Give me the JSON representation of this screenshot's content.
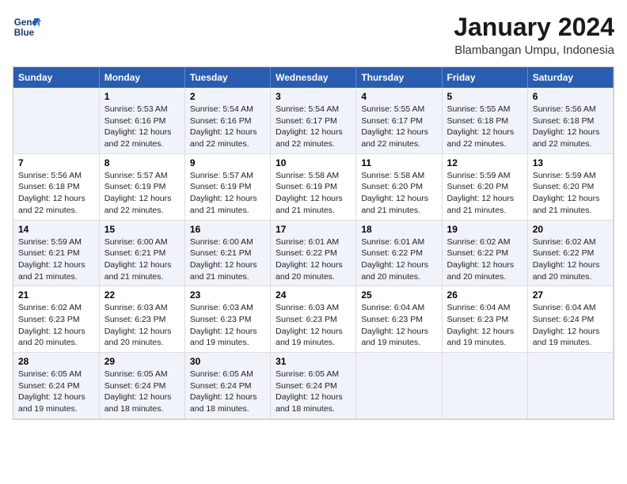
{
  "logo": {
    "line1": "General",
    "line2": "Blue"
  },
  "title": "January 2024",
  "subtitle": "Blambangan Umpu, Indonesia",
  "header_days": [
    "Sunday",
    "Monday",
    "Tuesday",
    "Wednesday",
    "Thursday",
    "Friday",
    "Saturday"
  ],
  "weeks": [
    [
      {
        "num": "",
        "info": ""
      },
      {
        "num": "1",
        "info": "Sunrise: 5:53 AM\nSunset: 6:16 PM\nDaylight: 12 hours\nand 22 minutes."
      },
      {
        "num": "2",
        "info": "Sunrise: 5:54 AM\nSunset: 6:16 PM\nDaylight: 12 hours\nand 22 minutes."
      },
      {
        "num": "3",
        "info": "Sunrise: 5:54 AM\nSunset: 6:17 PM\nDaylight: 12 hours\nand 22 minutes."
      },
      {
        "num": "4",
        "info": "Sunrise: 5:55 AM\nSunset: 6:17 PM\nDaylight: 12 hours\nand 22 minutes."
      },
      {
        "num": "5",
        "info": "Sunrise: 5:55 AM\nSunset: 6:18 PM\nDaylight: 12 hours\nand 22 minutes."
      },
      {
        "num": "6",
        "info": "Sunrise: 5:56 AM\nSunset: 6:18 PM\nDaylight: 12 hours\nand 22 minutes."
      }
    ],
    [
      {
        "num": "7",
        "info": "Sunrise: 5:56 AM\nSunset: 6:18 PM\nDaylight: 12 hours\nand 22 minutes."
      },
      {
        "num": "8",
        "info": "Sunrise: 5:57 AM\nSunset: 6:19 PM\nDaylight: 12 hours\nand 22 minutes."
      },
      {
        "num": "9",
        "info": "Sunrise: 5:57 AM\nSunset: 6:19 PM\nDaylight: 12 hours\nand 21 minutes."
      },
      {
        "num": "10",
        "info": "Sunrise: 5:58 AM\nSunset: 6:19 PM\nDaylight: 12 hours\nand 21 minutes."
      },
      {
        "num": "11",
        "info": "Sunrise: 5:58 AM\nSunset: 6:20 PM\nDaylight: 12 hours\nand 21 minutes."
      },
      {
        "num": "12",
        "info": "Sunrise: 5:59 AM\nSunset: 6:20 PM\nDaylight: 12 hours\nand 21 minutes."
      },
      {
        "num": "13",
        "info": "Sunrise: 5:59 AM\nSunset: 6:20 PM\nDaylight: 12 hours\nand 21 minutes."
      }
    ],
    [
      {
        "num": "14",
        "info": "Sunrise: 5:59 AM\nSunset: 6:21 PM\nDaylight: 12 hours\nand 21 minutes."
      },
      {
        "num": "15",
        "info": "Sunrise: 6:00 AM\nSunset: 6:21 PM\nDaylight: 12 hours\nand 21 minutes."
      },
      {
        "num": "16",
        "info": "Sunrise: 6:00 AM\nSunset: 6:21 PM\nDaylight: 12 hours\nand 21 minutes."
      },
      {
        "num": "17",
        "info": "Sunrise: 6:01 AM\nSunset: 6:22 PM\nDaylight: 12 hours\nand 20 minutes."
      },
      {
        "num": "18",
        "info": "Sunrise: 6:01 AM\nSunset: 6:22 PM\nDaylight: 12 hours\nand 20 minutes."
      },
      {
        "num": "19",
        "info": "Sunrise: 6:02 AM\nSunset: 6:22 PM\nDaylight: 12 hours\nand 20 minutes."
      },
      {
        "num": "20",
        "info": "Sunrise: 6:02 AM\nSunset: 6:22 PM\nDaylight: 12 hours\nand 20 minutes."
      }
    ],
    [
      {
        "num": "21",
        "info": "Sunrise: 6:02 AM\nSunset: 6:23 PM\nDaylight: 12 hours\nand 20 minutes."
      },
      {
        "num": "22",
        "info": "Sunrise: 6:03 AM\nSunset: 6:23 PM\nDaylight: 12 hours\nand 20 minutes."
      },
      {
        "num": "23",
        "info": "Sunrise: 6:03 AM\nSunset: 6:23 PM\nDaylight: 12 hours\nand 19 minutes."
      },
      {
        "num": "24",
        "info": "Sunrise: 6:03 AM\nSunset: 6:23 PM\nDaylight: 12 hours\nand 19 minutes."
      },
      {
        "num": "25",
        "info": "Sunrise: 6:04 AM\nSunset: 6:23 PM\nDaylight: 12 hours\nand 19 minutes."
      },
      {
        "num": "26",
        "info": "Sunrise: 6:04 AM\nSunset: 6:23 PM\nDaylight: 12 hours\nand 19 minutes."
      },
      {
        "num": "27",
        "info": "Sunrise: 6:04 AM\nSunset: 6:24 PM\nDaylight: 12 hours\nand 19 minutes."
      }
    ],
    [
      {
        "num": "28",
        "info": "Sunrise: 6:05 AM\nSunset: 6:24 PM\nDaylight: 12 hours\nand 19 minutes."
      },
      {
        "num": "29",
        "info": "Sunrise: 6:05 AM\nSunset: 6:24 PM\nDaylight: 12 hours\nand 18 minutes."
      },
      {
        "num": "30",
        "info": "Sunrise: 6:05 AM\nSunset: 6:24 PM\nDaylight: 12 hours\nand 18 minutes."
      },
      {
        "num": "31",
        "info": "Sunrise: 6:05 AM\nSunset: 6:24 PM\nDaylight: 12 hours\nand 18 minutes."
      },
      {
        "num": "",
        "info": ""
      },
      {
        "num": "",
        "info": ""
      },
      {
        "num": "",
        "info": ""
      }
    ]
  ]
}
